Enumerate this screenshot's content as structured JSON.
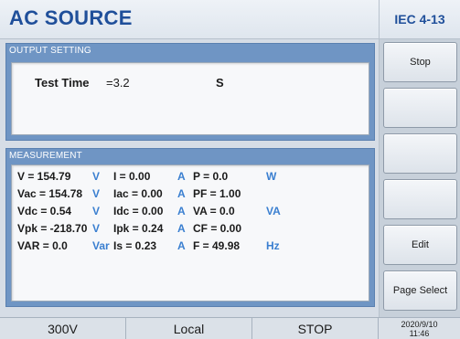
{
  "header": {
    "title": "AC SOURCE",
    "standard": "IEC 4-13"
  },
  "output_setting": {
    "label": "OUTPUT SETTING",
    "test_time_label": "Test  Time",
    "test_time_value": "=3.2",
    "test_time_unit": "S"
  },
  "measurement": {
    "label": "MEASUREMENT",
    "rows": [
      [
        "V   = 154.79",
        "V",
        "I     = 0.00",
        "A",
        "P     = 0.0",
        "W"
      ],
      [
        "Vac = 154.78",
        "V",
        "Iac  = 0.00",
        "A",
        "PF   = 1.00",
        ""
      ],
      [
        "Vdc = 0.54",
        "V",
        "Idc  = 0.00",
        "A",
        "VA   = 0.0",
        "VA"
      ],
      [
        "Vpk = -218.70",
        "V",
        "Ipk  = 0.24",
        "A",
        "CF   = 0.00",
        ""
      ],
      [
        "VAR = 0.0",
        "Var",
        "Is    = 0.23",
        "A",
        "F     = 49.98",
        "Hz"
      ]
    ]
  },
  "side_buttons": [
    "Stop",
    "",
    "",
    "",
    "Edit",
    "Page Select"
  ],
  "status_bar": {
    "voltage_range": "300V",
    "mode": "Local",
    "state": "STOP",
    "date": "2020/9/10",
    "time": "11:46"
  }
}
